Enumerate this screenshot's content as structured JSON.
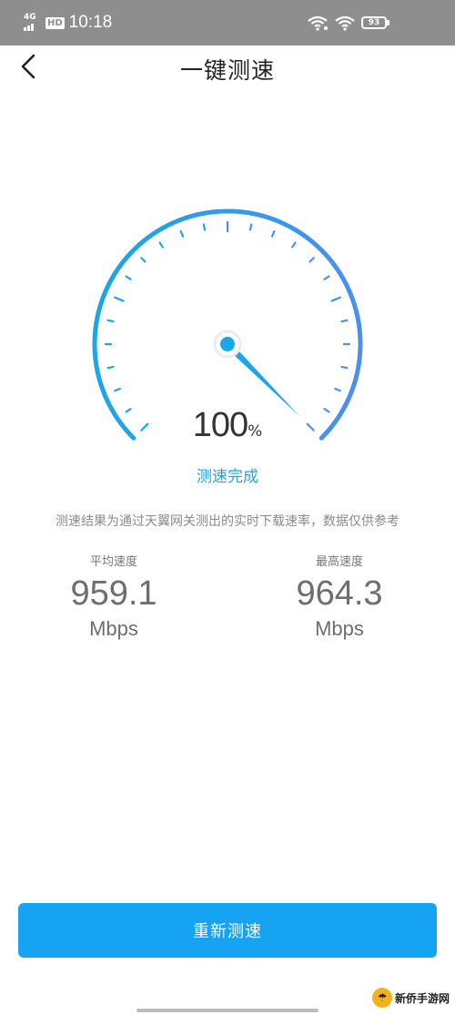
{
  "status_bar": {
    "network": "4G",
    "hd": "HD",
    "time": "10:18",
    "battery": "93",
    "icons": [
      "wifi-calling-icon",
      "wifi-icon",
      "battery-icon"
    ]
  },
  "header": {
    "title": "一键测速",
    "back_icon": "chevron-left-icon"
  },
  "gauge": {
    "progress_percent": 100,
    "value": "100",
    "unit": "%",
    "status": "测速完成",
    "accent_start": "#1aa6e8",
    "accent_end": "#4b8ff0"
  },
  "note": "测速结果为通过天翼网关测出的实时下载速率，数据仅供参考",
  "stats": {
    "average": {
      "label": "平均速度",
      "value": "959.1",
      "unit": "Mbps"
    },
    "max": {
      "label": "最高速度",
      "value": "964.3",
      "unit": "Mbps"
    }
  },
  "actions": {
    "retest_label": "重新测速"
  },
  "watermark": {
    "text": "新侨手游网"
  }
}
